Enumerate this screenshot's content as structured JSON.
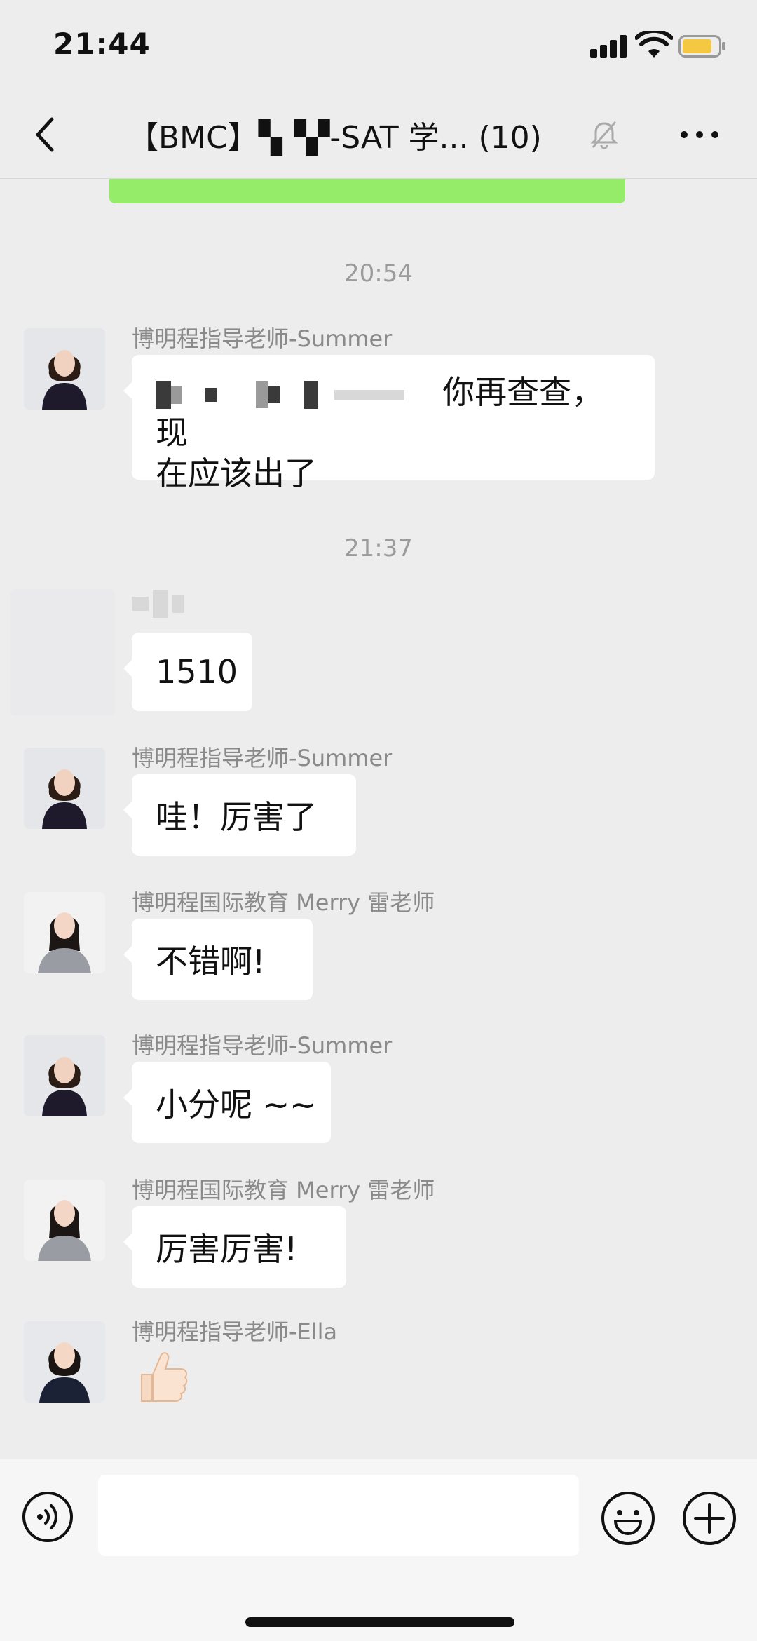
{
  "status_bar": {
    "time": "21:44"
  },
  "header": {
    "title": "【BMC】▚▝▞-SAT 学... (10)"
  },
  "timestamps": [
    "20:54",
    "21:37"
  ],
  "messages": [
    {
      "sender": "博明程指导老师-Summer",
      "text_visible": "你再查查，现",
      "text_line2": "在应该出了"
    },
    {
      "sender": "",
      "text": "1510"
    },
    {
      "sender": "博明程指导老师-Summer",
      "text": "哇！厉害了"
    },
    {
      "sender": "博明程国际教育 Merry 雷老师",
      "text": "不错啊!"
    },
    {
      "sender": "博明程指导老师-Summer",
      "text": "小分呢 ~~"
    },
    {
      "sender": "博明程国际教育 Merry 雷老师",
      "text": "厉害厉害!"
    },
    {
      "sender": "博明程指导老师-Ella",
      "sticker": "thumbs-up"
    }
  ],
  "input": {
    "value": ""
  },
  "colors": {
    "background": "#ededed",
    "bubble": "#ffffff",
    "accent_green": "#95ec69",
    "battery": "#f5c842"
  }
}
